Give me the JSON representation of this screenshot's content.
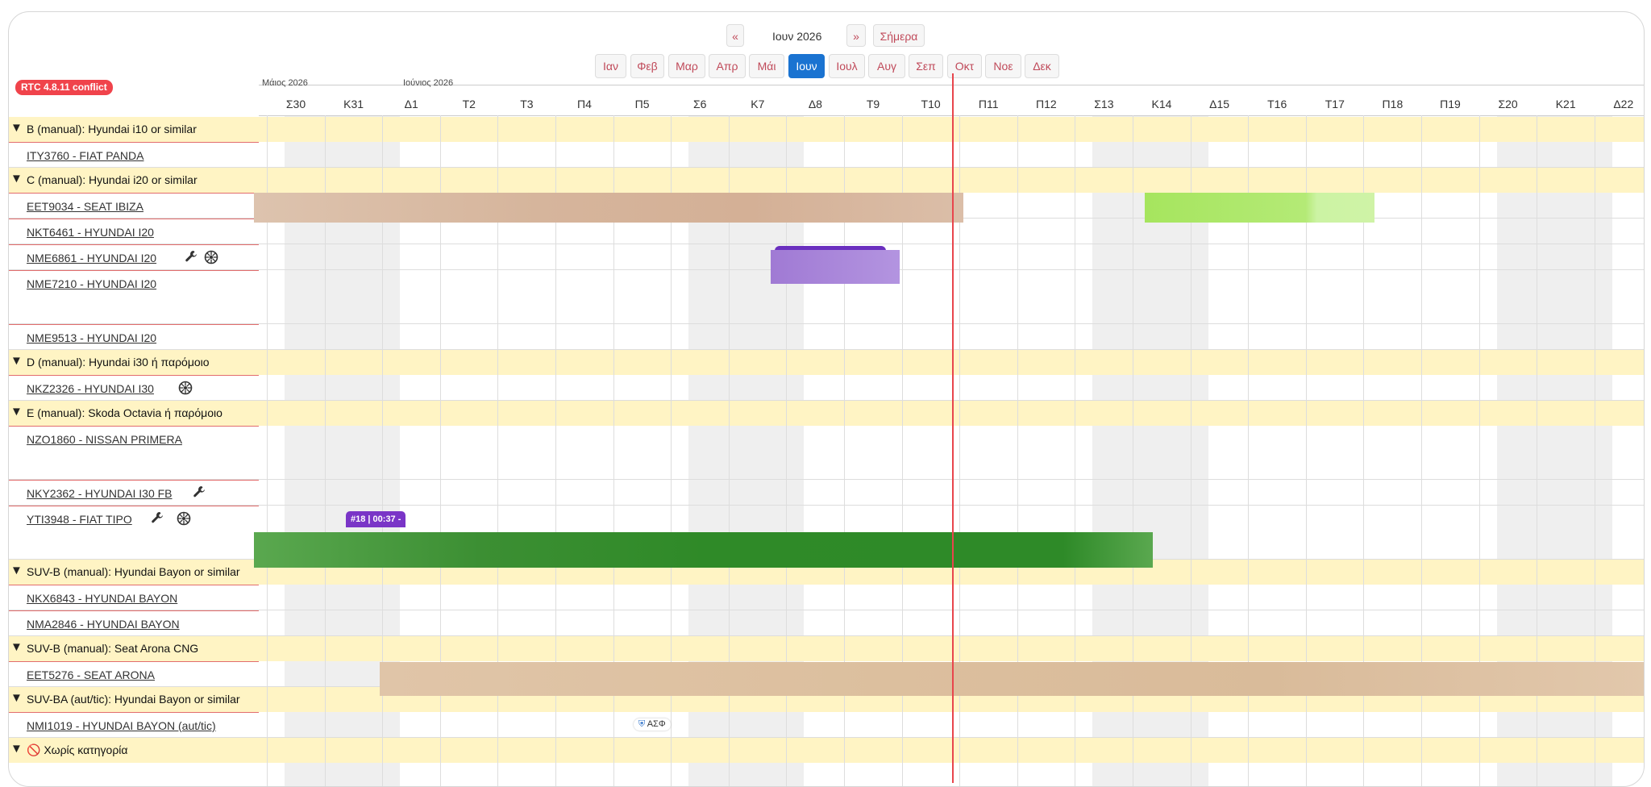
{
  "nav": {
    "prev": "«",
    "current": "Ιουν 2026",
    "next": "»",
    "today": "Σήμερα"
  },
  "months": [
    "Ιαν",
    "Φεβ",
    "Μαρ",
    "Απρ",
    "Μάι",
    "Ιουν",
    "Ιουλ",
    "Αυγ",
    "Σεπ",
    "Οκτ",
    "Νοε",
    "Δεκ"
  ],
  "active_month": "Ιουν",
  "conflict_badge": "RTC 4.8.11 conflict",
  "header": {
    "month_labels": [
      "Μάιος 2026",
      "Ιούνιος 2026"
    ],
    "days": [
      "Σ30",
      "Κ31",
      "Δ1",
      "Τ2",
      "Τ3",
      "Π4",
      "Π5",
      "Σ6",
      "Κ7",
      "Δ8",
      "Τ9",
      "Τ10",
      "Π11",
      "Π12",
      "Σ13",
      "Κ14",
      "Δ15",
      "Τ16",
      "Τ17",
      "Π18",
      "Π19",
      "Σ20",
      "Κ21",
      "Δ22"
    ]
  },
  "groups": [
    {
      "label": "B (manual): Hyundai i10 or similar",
      "cars": [
        "ITY3760 - FIAT PANDA"
      ]
    },
    {
      "label": "C (manual): Hyundai i20 or similar",
      "cars": [
        "EET9034 - SEAT IBIZA",
        "NKT6461 - HYUNDAI I20",
        "NME6861 - HYUNDAI I20",
        "NME7210 - HYUNDAI I20",
        "NME9513 - HYUNDAI I20"
      ]
    },
    {
      "label": "D (manual): Hyundai i30 ή παρόμοιο",
      "cars": [
        "NKZ2326 - HYUNDAI I30"
      ]
    },
    {
      "label": "E (manual): Skoda Octavia ή παρόμοιο",
      "cars": [
        "NZO1860 - NISSAN PRIMERA",
        "NKY2362 - HYUNDAI I30 FB",
        "YTI3948 - FIAT TIPO"
      ]
    },
    {
      "label": "SUV-B (manual): Hyundai Bayon or similar",
      "cars": [
        "NKX6843 - HYUNDAI BAYON",
        "NMA2846 - HYUNDAI BAYON"
      ]
    },
    {
      "label": "SUV-B (manual): Seat Arona CNG",
      "cars": [
        "EET5276 - SEAT ARONA"
      ]
    },
    {
      "label": "SUV-BA (aut/tic): Hyundai Bayon or similar",
      "cars": [
        "NMI1019 - HYUNDAI BAYON (aut/tic)"
      ]
    },
    {
      "label": "🚫 Χωρίς κατηγορία",
      "cars": []
    }
  ],
  "booking_tag": "#18 | 00:37 -",
  "asf_badge": "ΑΣΦ",
  "colors": {
    "accent": "#1a73d1",
    "conflict": "#f0434b",
    "today": "#e8454c",
    "group_bg": "#fff4c4",
    "booking_tan": "#d8b9a0",
    "booking_lime": "#aee86a",
    "booking_purple": "#a47ed6",
    "booking_green": "#35922d"
  }
}
